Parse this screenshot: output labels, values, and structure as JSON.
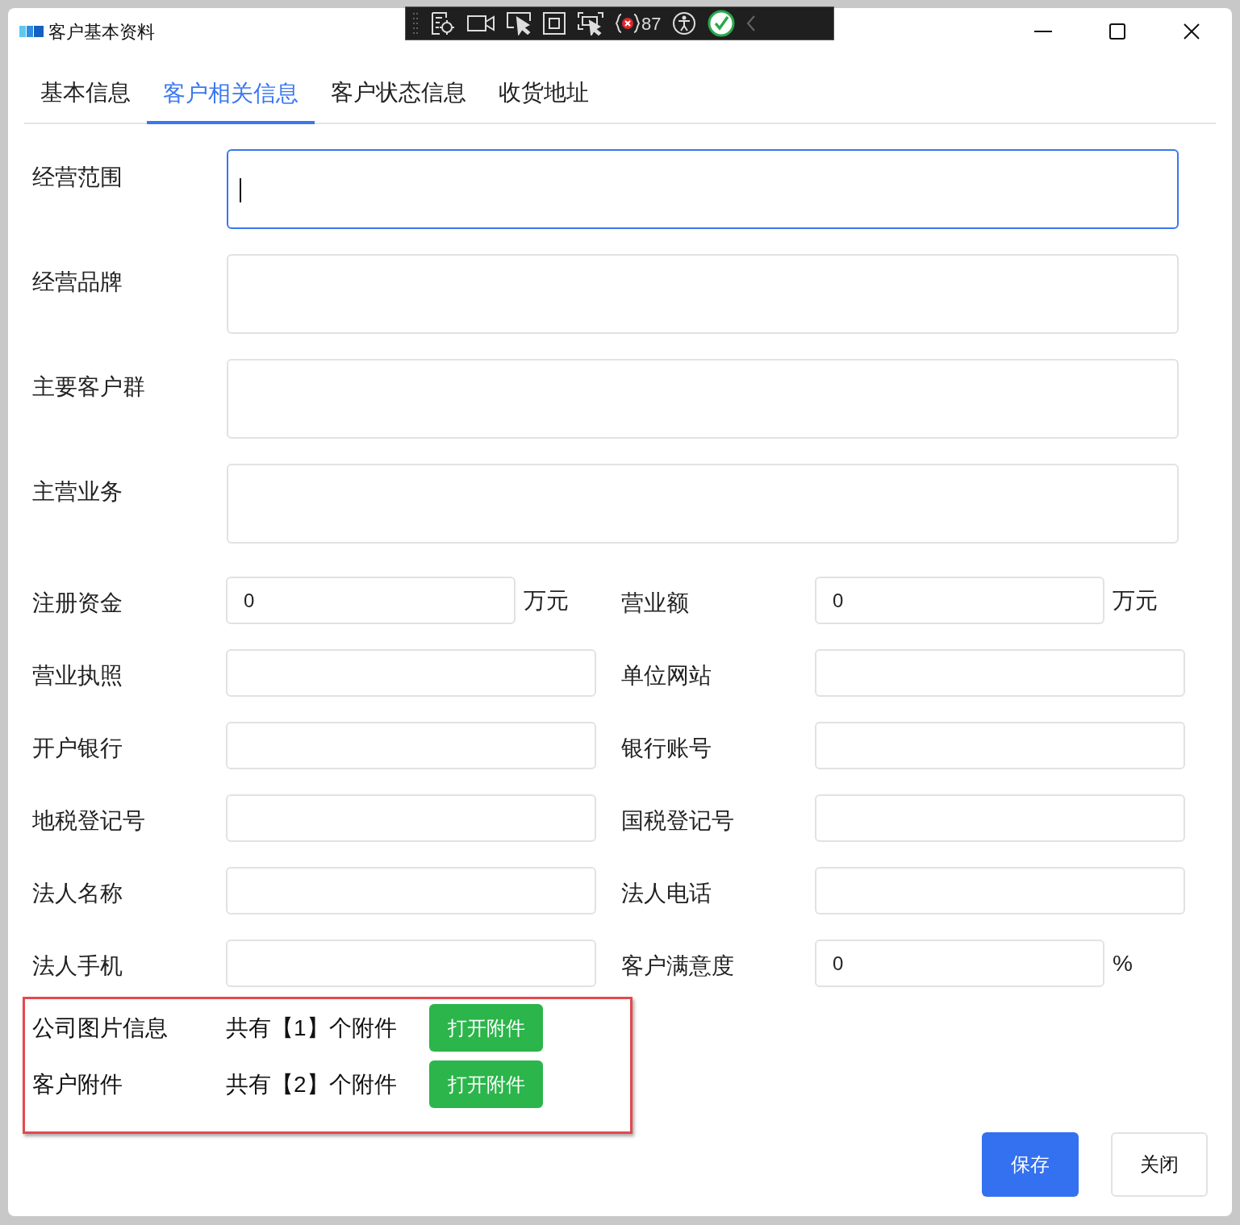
{
  "window": {
    "title": "客户基本资料"
  },
  "debug_toolbar": {
    "error_count": "87",
    "check_ok": true
  },
  "tabs": [
    {
      "label": "基本信息",
      "selected": false
    },
    {
      "label": "客户相关信息",
      "selected": true
    },
    {
      "label": "客户状态信息",
      "selected": false
    },
    {
      "label": "收货地址",
      "selected": false
    }
  ],
  "text_areas": [
    {
      "label": "经营范围",
      "focused": true
    },
    {
      "label": "经营品牌",
      "focused": false
    },
    {
      "label": "主要客户群",
      "focused": false
    },
    {
      "label": "主营业务",
      "focused": false
    }
  ],
  "field_rows": [
    [
      {
        "label": "注册资金",
        "value": "0",
        "unit": "万元"
      },
      {
        "label": "营业额",
        "value": "0",
        "unit": "万元"
      }
    ],
    [
      {
        "label": "营业执照"
      },
      {
        "label": "单位网站"
      }
    ],
    [
      {
        "label": "开户银行"
      },
      {
        "label": "银行账号"
      }
    ],
    [
      {
        "label": "地税登记号"
      },
      {
        "label": "国税登记号"
      }
    ],
    [
      {
        "label": "法人名称"
      },
      {
        "label": "法人电话"
      }
    ],
    [
      {
        "label": "法人手机"
      },
      {
        "label": "客户满意度",
        "value": "0",
        "unit": "%"
      }
    ]
  ],
  "attachments": [
    {
      "label": "公司图片信息",
      "count_text": "共有【1】个附件",
      "button": "打开附件"
    },
    {
      "label": "客户附件",
      "count_text": "共有【2】个附件",
      "button": "打开附件"
    }
  ],
  "buttons": [
    {
      "label": "保存",
      "kind": "primary"
    },
    {
      "label": "关闭",
      "kind": "secondary"
    }
  ]
}
